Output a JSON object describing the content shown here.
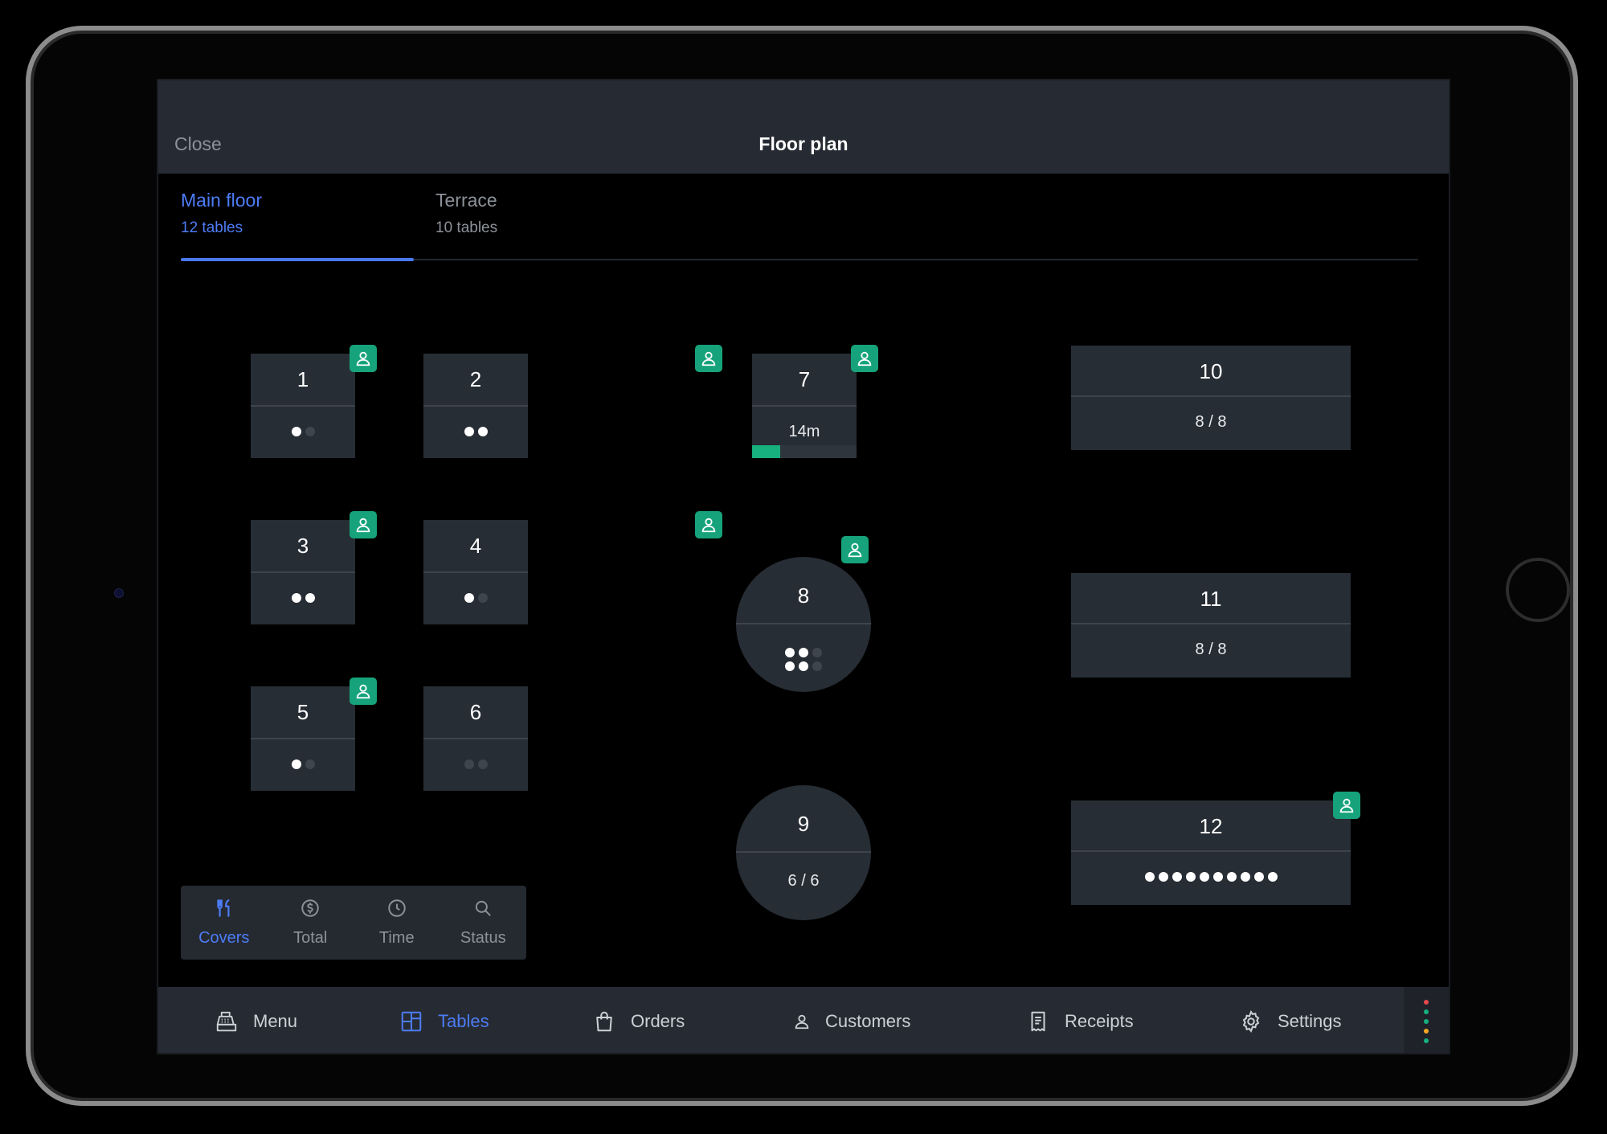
{
  "header": {
    "close_label": "Close",
    "title": "Floor plan"
  },
  "floors": [
    {
      "name": "Main floor",
      "count": "12 tables",
      "active": true
    },
    {
      "name": "Terrace",
      "count": "10 tables",
      "active": false
    }
  ],
  "tables": [
    {
      "number": "1",
      "shape": "square",
      "guest": true,
      "covers": 1,
      "seats": 2
    },
    {
      "number": "2",
      "shape": "square",
      "guest": true,
      "covers": 2,
      "seats": 2
    },
    {
      "number": "3",
      "shape": "square",
      "guest": true,
      "covers": 2,
      "seats": 2
    },
    {
      "number": "4",
      "shape": "square",
      "guest": true,
      "covers": 1,
      "seats": 2
    },
    {
      "number": "5",
      "shape": "square",
      "guest": true,
      "covers": 1,
      "seats": 2
    },
    {
      "number": "6",
      "shape": "square",
      "guest": false,
      "covers": 0,
      "seats": 2
    },
    {
      "number": "7",
      "shape": "square",
      "guest": true,
      "time": "14m",
      "progress": 0.27
    },
    {
      "number": "8",
      "shape": "round",
      "guest": true,
      "covers": 4,
      "seats": 6
    },
    {
      "number": "9",
      "shape": "round",
      "guest": false,
      "ratio": "6 / 6"
    },
    {
      "number": "10",
      "shape": "rect",
      "guest": false,
      "ratio": "8 / 8"
    },
    {
      "number": "11",
      "shape": "rect",
      "guest": false,
      "ratio": "8 / 8"
    },
    {
      "number": "12",
      "shape": "rect",
      "guest": true,
      "covers": 10,
      "seats": 10
    }
  ],
  "view_toggle": [
    {
      "label": "Covers",
      "icon": "cutlery-icon",
      "active": true
    },
    {
      "label": "Total",
      "icon": "dollar-icon",
      "active": false
    },
    {
      "label": "Time",
      "icon": "clock-icon",
      "active": false
    },
    {
      "label": "Status",
      "icon": "search-icon",
      "active": false
    }
  ],
  "bottom_nav": [
    {
      "label": "Menu",
      "icon": "cash-register-icon",
      "active": false
    },
    {
      "label": "Tables",
      "icon": "grid-icon",
      "active": true
    },
    {
      "label": "Orders",
      "icon": "bag-icon",
      "active": false
    },
    {
      "label": "Customers",
      "icon": "user-icon",
      "active": false
    },
    {
      "label": "Receipts",
      "icon": "receipt-icon",
      "active": false
    },
    {
      "label": "Settings",
      "icon": "gear-icon",
      "active": false
    }
  ],
  "colors": {
    "accent": "#4d7cf5",
    "guest_badge": "#16a37b",
    "status_dots": [
      "#e5484d",
      "#17b07f",
      "#17b07f",
      "#f5a623",
      "#17b07f"
    ]
  }
}
